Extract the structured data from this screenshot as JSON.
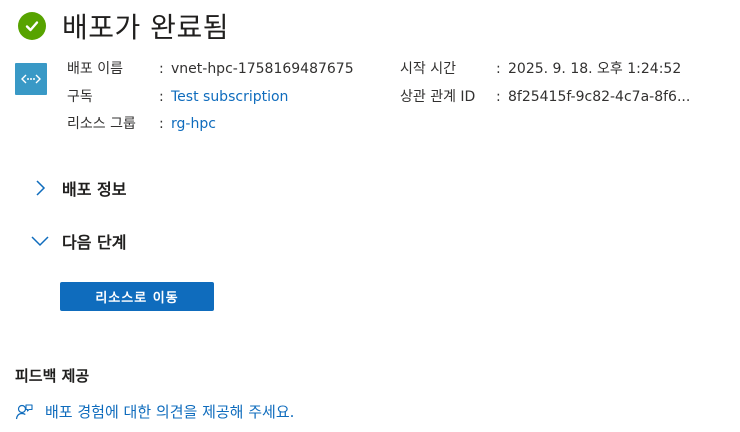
{
  "header": {
    "title": "배포가 완료됨"
  },
  "details": {
    "deployment_name_label": "배포 이름",
    "deployment_name_value": "vnet-hpc-1758169487675",
    "subscription_label": "구독",
    "subscription_value": "Test subscription",
    "resource_group_label": "리소스 그룹",
    "resource_group_value": "rg-hpc",
    "start_time_label": "시작 시간",
    "start_time_value": "2025. 9. 18. 오후 1:24:52",
    "correlation_id_label": "상관 관계 ID",
    "correlation_id_value": "8f25415f-9c82-4c7a-8f6...",
    "colon": ":"
  },
  "sections": {
    "deployment_details": "배포 정보",
    "next_steps": "다음 단계"
  },
  "actions": {
    "go_to_resource": "리소스로 이동"
  },
  "feedback": {
    "title": "피드백 제공",
    "link": "배포 경험에 대한 의견을 제공해 주세요."
  },
  "colors": {
    "accent": "#0f6cbd",
    "success": "#57a300",
    "resource_icon": "#3999c6"
  },
  "icons": {
    "status": "success-check-icon",
    "resource": "virtual-network-icon",
    "collapsed": "chevron-right-icon",
    "expanded": "chevron-down-icon",
    "feedback": "person-feedback-icon"
  }
}
